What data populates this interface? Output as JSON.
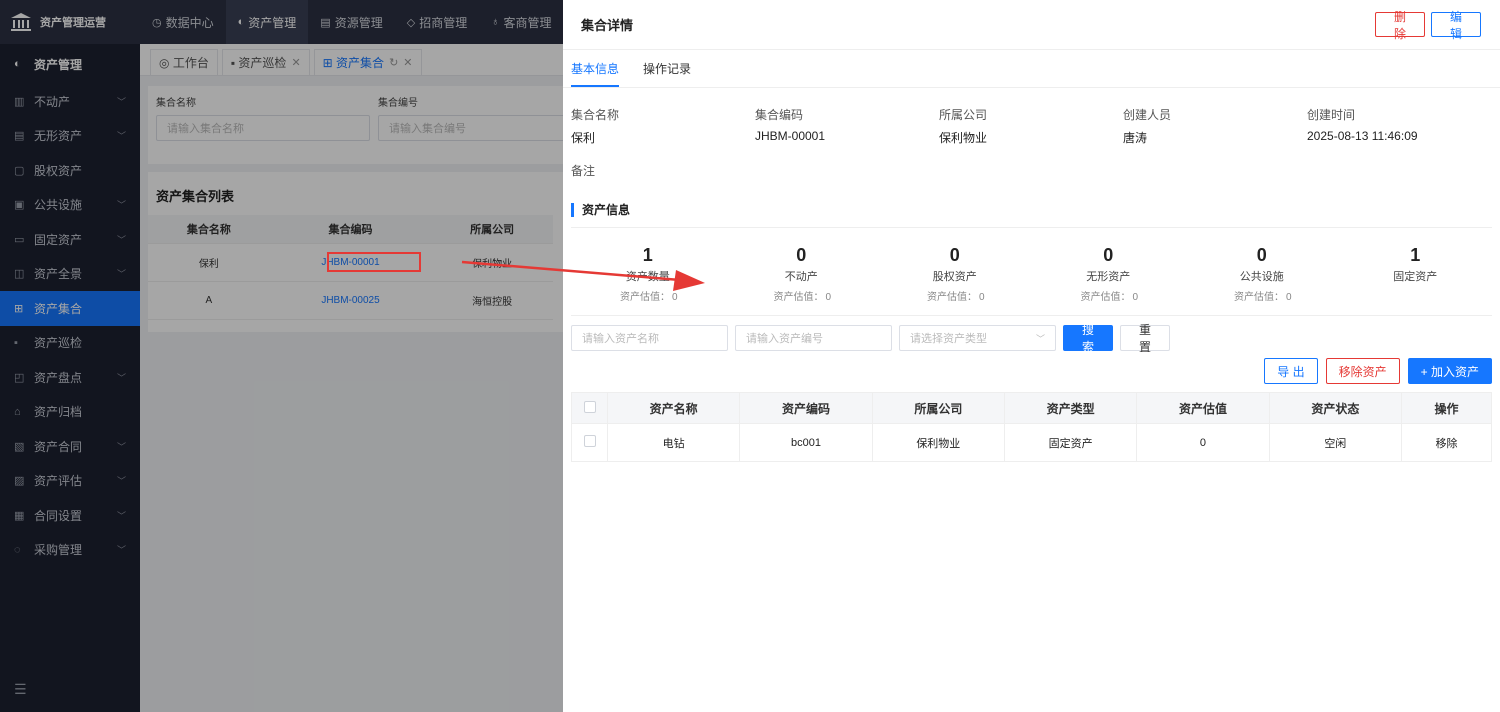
{
  "topbar": {
    "app_title": "资产管理运营",
    "nav": [
      {
        "label": "数据中心",
        "icon": "clock-icon"
      },
      {
        "label": "资产管理",
        "icon": "shield-icon"
      },
      {
        "label": "资源管理",
        "icon": "document-icon"
      },
      {
        "label": "招商管理",
        "icon": "diamond-icon"
      },
      {
        "label": "客商管理",
        "icon": "users-icon"
      }
    ]
  },
  "sidebar": {
    "header": "资产管理",
    "items": [
      {
        "label": "不动产",
        "has_children": true
      },
      {
        "label": "无形资产",
        "has_children": true
      },
      {
        "label": "股权资产",
        "has_children": false
      },
      {
        "label": "公共设施",
        "has_children": true
      },
      {
        "label": "固定资产",
        "has_children": true
      },
      {
        "label": "资产全景",
        "has_children": true
      },
      {
        "label": "资产集合",
        "has_children": false
      },
      {
        "label": "资产巡检",
        "has_children": false
      },
      {
        "label": "资产盘点",
        "has_children": true
      },
      {
        "label": "资产归档",
        "has_children": false
      },
      {
        "label": "资产合同",
        "has_children": true
      },
      {
        "label": "资产评估",
        "has_children": true
      },
      {
        "label": "合同设置",
        "has_children": true
      },
      {
        "label": "采购管理",
        "has_children": true
      }
    ],
    "active_index": 6
  },
  "main": {
    "tabs": [
      {
        "label": "工作台"
      },
      {
        "label": "资产巡检"
      },
      {
        "label": "资产集合"
      }
    ],
    "filter": {
      "name_label": "集合名称",
      "name_placeholder": "请输入集合名称",
      "code_label": "集合编号",
      "code_placeholder": "请输入集合编号"
    },
    "list_title": "资产集合列表",
    "list_headers": [
      "集合名称",
      "集合编码",
      "所属公司"
    ],
    "list_rows": [
      {
        "name": "保利",
        "code": "JHBM-00001",
        "company": "保利物业"
      },
      {
        "name": "A",
        "code": "JHBM-00025",
        "company": "海恒控股"
      }
    ]
  },
  "drawer": {
    "title": "集合详情",
    "delete_label": "删 除",
    "edit_label": "编 辑",
    "tabs": [
      "基本信息",
      "操作记录"
    ],
    "info": [
      {
        "key": "集合名称",
        "value": "保利"
      },
      {
        "key": "集合编码",
        "value": "JHBM-00001"
      },
      {
        "key": "所属公司",
        "value": "保利物业"
      },
      {
        "key": "创建人员",
        "value": "唐涛"
      },
      {
        "key": "创建时间",
        "value": "2025-08-13 11:46:09"
      }
    ],
    "remark_label": "备注",
    "section_title": "资产信息",
    "stats": [
      {
        "num": "1",
        "name": "资产数量",
        "eval_label": "资产估值：",
        "eval": "0"
      },
      {
        "num": "0",
        "name": "不动产",
        "eval_label": "资产估值：",
        "eval": "0"
      },
      {
        "num": "0",
        "name": "股权资产",
        "eval_label": "资产估值：",
        "eval": "0"
      },
      {
        "num": "0",
        "name": "无形资产",
        "eval_label": "资产估值：",
        "eval": "0"
      },
      {
        "num": "0",
        "name": "公共设施",
        "eval_label": "资产估值：",
        "eval": "0"
      },
      {
        "num": "1",
        "name": "固定资产"
      }
    ],
    "search": {
      "name_placeholder": "请输入资产名称",
      "code_placeholder": "请输入资产编号",
      "type_placeholder": "请选择资产类型",
      "search_label": "搜 索",
      "reset_label": "重 置"
    },
    "actions": {
      "export_label": "导 出",
      "remove_label": "移除资产",
      "add_label": "+ 加入资产"
    },
    "table_headers": [
      "资产名称",
      "资产编码",
      "所属公司",
      "资产类型",
      "资产估值",
      "资产状态",
      "操作"
    ],
    "table_rows": [
      {
        "name": "电钻",
        "code": "bc001",
        "company": "保利物业",
        "type": "固定资产",
        "value": "0",
        "status": "空闲",
        "op": "移除"
      }
    ]
  },
  "colors": {
    "primary": "#1677ff",
    "danger": "#e53935",
    "sidebar_bg": "#1d2130",
    "topbar_bg": "#2c3142"
  }
}
